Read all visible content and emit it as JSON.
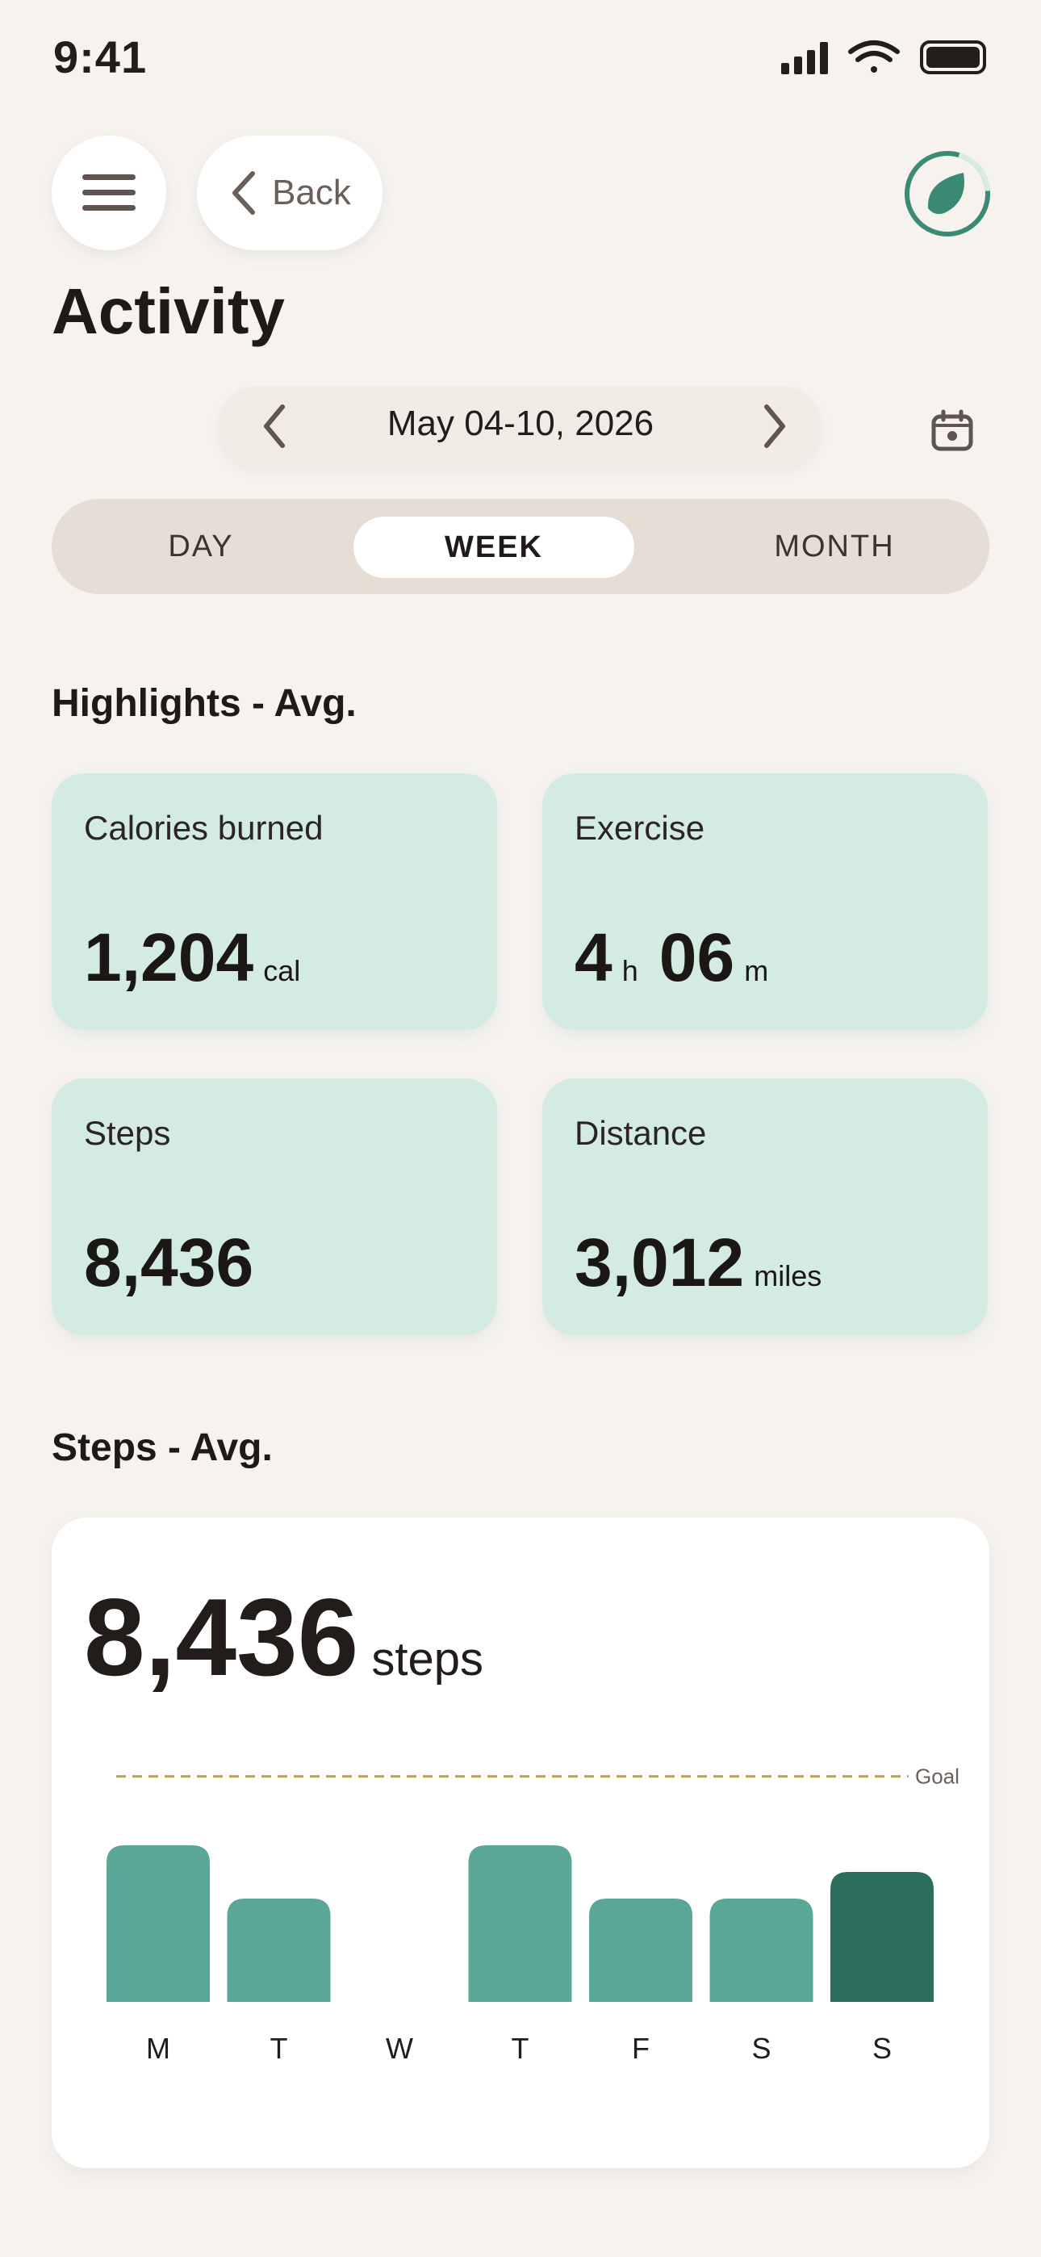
{
  "status_bar": {
    "time": "9:41"
  },
  "nav": {
    "back_label": "Back"
  },
  "header": {
    "title": "Activity"
  },
  "date_range": {
    "label": "May 04-10, 2026"
  },
  "period_tabs": [
    {
      "label": "DAY",
      "selected": false
    },
    {
      "label": "WEEK",
      "selected": true
    },
    {
      "label": "MONTH",
      "selected": false
    }
  ],
  "highlights": {
    "title": "Highlights - Avg.",
    "calories": {
      "label": "Calories burned",
      "value": "1,204",
      "unit": "cal"
    },
    "exercise": {
      "label": "Exercise",
      "hours": "4",
      "hours_unit": "h",
      "minutes": "06",
      "minutes_unit": "m"
    },
    "steps": {
      "label": "Steps",
      "value": "8,436"
    },
    "distance": {
      "label": "Distance",
      "value": "3,012",
      "unit": "miles"
    }
  },
  "steps_section": {
    "title": "Steps - Avg.",
    "value": "8,436",
    "unit": "steps"
  },
  "colors": {
    "bar": "#5ba797",
    "bar_selected": "#2b6e5e",
    "goal_line": "#c9a23c",
    "card_bg": "#d4ebe4",
    "accent": "#3a8a74"
  },
  "chart_data": {
    "type": "bar",
    "categories": [
      "M",
      "T",
      "W",
      "T",
      "F",
      "S",
      "S"
    ],
    "values": [
      1.0,
      0.66,
      0,
      1.0,
      0.66,
      0.66,
      0.83
    ],
    "highlight_index": 6,
    "goal": 1.44,
    "goal_label": "Goal",
    "ylim": [
      0,
      1.44
    ]
  }
}
